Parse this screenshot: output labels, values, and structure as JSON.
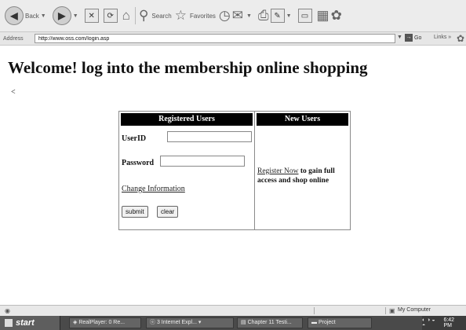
{
  "toolbar": {
    "back_label": "Back",
    "search_label": "Search",
    "favorites_label": "Favorites"
  },
  "address_bar": {
    "label": "Address",
    "url": "http://www.oss.com/login.asp",
    "go_label": "Go",
    "links_label": "Links"
  },
  "page": {
    "title": "Welcome! log into the membership online shopping",
    "back_link": "<",
    "registered_header": "Registered Users",
    "new_header": "New Users",
    "userid_label": "UserID",
    "password_label": "Password",
    "change_info_link": "Change Information",
    "submit_label": "submit",
    "clear_label": "clear",
    "register_link": "Register Now",
    "register_text": " to gain full access and shop online"
  },
  "status_bar": {
    "zone": "My Computer"
  },
  "taskbar": {
    "start_label": "start",
    "tasks": [
      "RealPlayer: 0 Re...",
      "3 Internet Expl...",
      "Chapter 11 Testi...",
      "Project"
    ],
    "clock": "6:42 PM"
  }
}
